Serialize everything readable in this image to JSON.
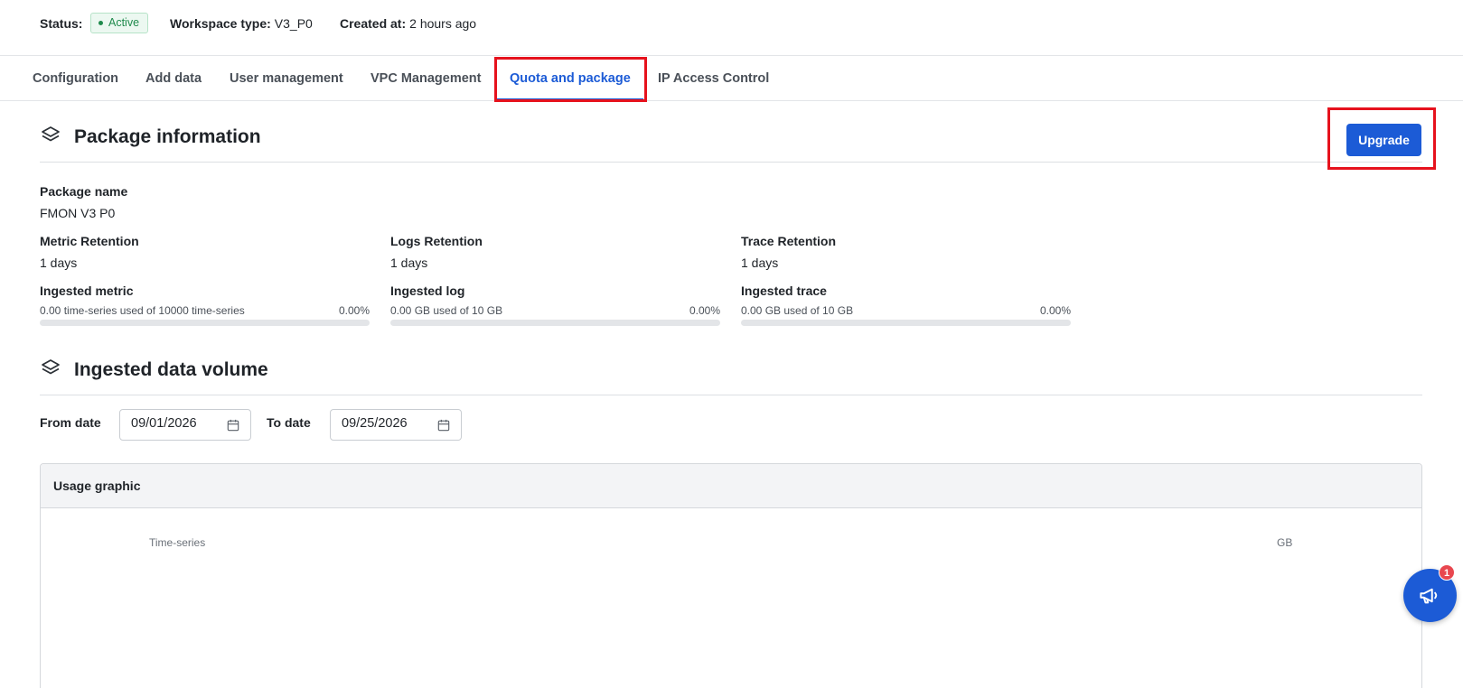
{
  "status_bar": {
    "status_label": "Status:",
    "status_value": "Active",
    "workspace_type_label": "Workspace type:",
    "workspace_type_value": "V3_P0",
    "created_at_label": "Created at:",
    "created_at_value": "2 hours ago"
  },
  "tabs": [
    {
      "label": "Configuration",
      "active": false
    },
    {
      "label": "Add data",
      "active": false
    },
    {
      "label": "User management",
      "active": false
    },
    {
      "label": "VPC Management",
      "active": false
    },
    {
      "label": "Quota and package",
      "active": true
    },
    {
      "label": "IP Access Control",
      "active": false
    }
  ],
  "package_info": {
    "title": "Package information",
    "upgrade_label": "Upgrade",
    "package_name_label": "Package name",
    "package_name_value": "FMON V3 P0",
    "metric_retention_label": "Metric Retention",
    "metric_retention_value": "1 days",
    "logs_retention_label": "Logs Retention",
    "logs_retention_value": "1 days",
    "trace_retention_label": "Trace Retention",
    "trace_retention_value": "1 days",
    "usage": [
      {
        "label": "Ingested metric",
        "detail": "0.00 time-series used of 10000 time-series",
        "percent_text": "0.00%",
        "percent": 0
      },
      {
        "label": "Ingested log",
        "detail": "0.00 GB used of 10 GB",
        "percent_text": "0.00%",
        "percent": 0
      },
      {
        "label": "Ingested trace",
        "detail": "0.00 GB used of 10 GB",
        "percent_text": "0.00%",
        "percent": 0
      }
    ]
  },
  "ingested_volume": {
    "title": "Ingested data volume",
    "from_label": "From date",
    "from_value": "09/01/2026",
    "to_label": "To date",
    "to_value": "09/25/2026",
    "panel_title": "Usage graphic",
    "left_axis": "Time-series",
    "right_axis": "GB"
  },
  "notifications": {
    "count": "1"
  },
  "colors": {
    "accent": "#1c5bd6",
    "active_badge": "#1f8a4c",
    "highlight": "#e6121d",
    "notification_badge": "#e8474f"
  },
  "icons": [
    "layers-icon",
    "calendar-icon",
    "megaphone-icon",
    "status-dot-icon"
  ]
}
